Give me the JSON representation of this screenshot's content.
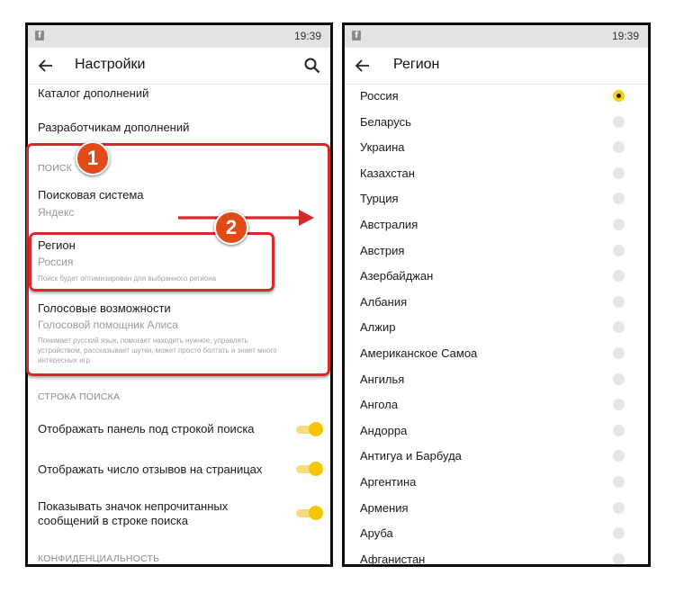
{
  "left": {
    "status": {
      "time": "19:39",
      "notification_icon": "facebook-icon"
    },
    "appbar": {
      "title": "Настройки",
      "back_icon": "arrow-left-icon",
      "search_icon": "search-icon"
    },
    "items": {
      "addons_catalog": "Каталог дополнений",
      "addons_devs": "Разработчикам дополнений",
      "search_section": "ПОИСК",
      "search_engine_label": "Поисковая система",
      "search_engine_value": "Яндекс",
      "region_label": "Регион",
      "region_value": "Россия",
      "region_desc": "Поиск будет оптимизирован для выбранного региона",
      "voice_label": "Голосовые возможности",
      "voice_value": "Голосовой помощник Алиса",
      "voice_desc_1": "Понимает русский язык, помогает находить нужное, управлять",
      "voice_desc_2": "устройством, рассказывает шутки, может просто болтать и знает много",
      "voice_desc_3": "интересных игр",
      "searchbar_section": "СТРОКА ПОИСКА",
      "toggle1_label": "Отображать панель под строкой поиска",
      "toggle2_label": "Отображать число отзывов на страницах",
      "toggle3_label_1": "Показывать значок непрочитанных",
      "toggle3_label_2": "сообщений в строке поиска",
      "privacy_section": "КОНФИДЕНЦИАЛЬНОСТЬ"
    },
    "toggles": {
      "panel_under_search": true,
      "reviews_count": true,
      "unread_badge": true
    }
  },
  "right": {
    "status": {
      "time": "19:39",
      "notification_icon": "facebook-icon"
    },
    "appbar": {
      "title": "Регион",
      "back_icon": "arrow-left-icon"
    },
    "selected": "Россия",
    "countries": [
      "Россия",
      "Беларусь",
      "Украина",
      "Казахстан",
      "Турция",
      "Австралия",
      "Австрия",
      "Азербайджан",
      "Албания",
      "Алжир",
      "Американское Самоа",
      "Ангилья",
      "Ангола",
      "Андорра",
      "Антигуа и Барбуда",
      "Аргентина",
      "Армения",
      "Аруба",
      "Афганистан"
    ]
  },
  "annotations": {
    "badge1": "1",
    "badge2": "2",
    "accent_red": "#d42a2a",
    "accent_yellow": "#f5c600"
  }
}
